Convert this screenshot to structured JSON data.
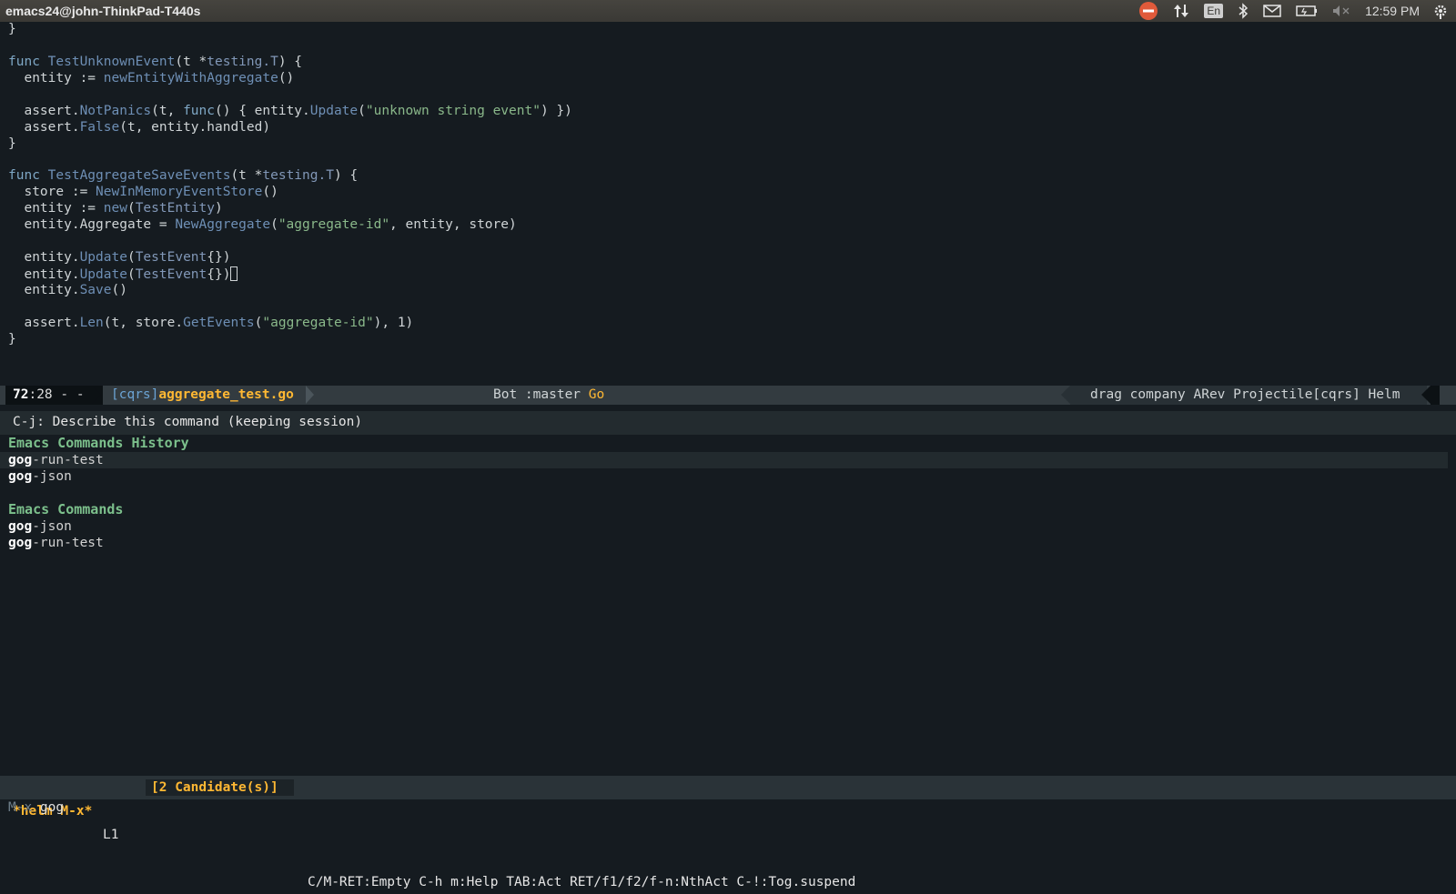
{
  "window": {
    "title": "emacs24@john-ThinkPad-T440s"
  },
  "tray": {
    "lang": "En",
    "clock": "12:59 PM"
  },
  "editor": {
    "lines": [
      [
        {
          "t": "}",
          "c": ""
        }
      ],
      [
        {
          "t": "",
          "c": ""
        }
      ],
      [
        {
          "t": "func ",
          "c": "kw"
        },
        {
          "t": "TestUnknownEvent",
          "c": "fn"
        },
        {
          "t": "(t *",
          "c": ""
        },
        {
          "t": "testing.T",
          "c": "ty"
        },
        {
          "t": ") {",
          "c": ""
        }
      ],
      [
        {
          "t": "  entity := ",
          "c": ""
        },
        {
          "t": "newEntityWithAggregate",
          "c": "fn"
        },
        {
          "t": "()",
          "c": ""
        }
      ],
      [
        {
          "t": "",
          "c": ""
        }
      ],
      [
        {
          "t": "  assert.",
          "c": ""
        },
        {
          "t": "NotPanics",
          "c": "fn"
        },
        {
          "t": "(t, ",
          "c": ""
        },
        {
          "t": "func",
          "c": "kw"
        },
        {
          "t": "() { entity.",
          "c": ""
        },
        {
          "t": "Update",
          "c": "fn"
        },
        {
          "t": "(",
          "c": ""
        },
        {
          "t": "\"unknown string event\"",
          "c": "str"
        },
        {
          "t": ") })",
          "c": ""
        }
      ],
      [
        {
          "t": "  assert.",
          "c": ""
        },
        {
          "t": "False",
          "c": "fn"
        },
        {
          "t": "(t, entity.handled)",
          "c": ""
        }
      ],
      [
        {
          "t": "}",
          "c": ""
        }
      ],
      [
        {
          "t": "",
          "c": ""
        }
      ],
      [
        {
          "t": "func ",
          "c": "kw"
        },
        {
          "t": "TestAggregateSaveEvents",
          "c": "fn"
        },
        {
          "t": "(t *",
          "c": ""
        },
        {
          "t": "testing.T",
          "c": "ty"
        },
        {
          "t": ") {",
          "c": ""
        }
      ],
      [
        {
          "t": "  store := ",
          "c": ""
        },
        {
          "t": "NewInMemoryEventStore",
          "c": "fn"
        },
        {
          "t": "()",
          "c": ""
        }
      ],
      [
        {
          "t": "  entity := ",
          "c": ""
        },
        {
          "t": "new",
          "c": "fn"
        },
        {
          "t": "(",
          "c": ""
        },
        {
          "t": "TestEntity",
          "c": "ty"
        },
        {
          "t": ")",
          "c": ""
        }
      ],
      [
        {
          "t": "  entity.Aggregate = ",
          "c": ""
        },
        {
          "t": "NewAggregate",
          "c": "fn"
        },
        {
          "t": "(",
          "c": ""
        },
        {
          "t": "\"aggregate-id\"",
          "c": "str"
        },
        {
          "t": ", entity, store)",
          "c": ""
        }
      ],
      [
        {
          "t": "",
          "c": ""
        }
      ],
      [
        {
          "t": "  entity.",
          "c": ""
        },
        {
          "t": "Update",
          "c": "fn"
        },
        {
          "t": "(",
          "c": ""
        },
        {
          "t": "TestEvent",
          "c": "ty"
        },
        {
          "t": "{})",
          "c": ""
        }
      ],
      [
        {
          "t": "  entity.",
          "c": ""
        },
        {
          "t": "Update",
          "c": "fn"
        },
        {
          "t": "(",
          "c": ""
        },
        {
          "t": "TestEvent",
          "c": "ty"
        },
        {
          "t": "{})",
          "c": ""
        },
        {
          "t": "",
          "c": "cursor"
        }
      ],
      [
        {
          "t": "  entity.",
          "c": ""
        },
        {
          "t": "Save",
          "c": "fn"
        },
        {
          "t": "()",
          "c": ""
        }
      ],
      [
        {
          "t": "",
          "c": ""
        }
      ],
      [
        {
          "t": "  assert.",
          "c": ""
        },
        {
          "t": "Len",
          "c": "fn"
        },
        {
          "t": "(t, store.",
          "c": ""
        },
        {
          "t": "GetEvents",
          "c": "fn"
        },
        {
          "t": "(",
          "c": ""
        },
        {
          "t": "\"aggregate-id\"",
          "c": "str"
        },
        {
          "t": "), 1)",
          "c": ""
        }
      ],
      [
        {
          "t": "}",
          "c": ""
        }
      ]
    ]
  },
  "modeline": {
    "line": "72",
    "col_rest": ":28 - -",
    "project": "[cqrs]",
    "file": "aggregate_test.go",
    "center": "Bot :master ",
    "lang": "Go",
    "minor_modes": "drag company ARev Projectile[cqrs] Helm"
  },
  "helm": {
    "header": "C-j: Describe this command (keeping session)",
    "sources": [
      {
        "title": "Emacs Commands History",
        "items": [
          {
            "match": "gog",
            "rest": "-run-test"
          },
          {
            "match": "gog",
            "rest": "-json"
          }
        ]
      },
      {
        "title": "Emacs Commands",
        "items": [
          {
            "match": "gog",
            "rest": "-json"
          },
          {
            "match": "gog",
            "rest": "-run-test"
          }
        ]
      }
    ],
    "modeline": {
      "name": "*helm M-x*",
      "line": "L1",
      "count": "[2 Candidate(s)]",
      "keys": "C/M-RET:Empty C-h m:Help TAB:Act RET/f1/f2/f-n:NthAct C-!:Tog.suspend"
    }
  },
  "minibuffer": {
    "prompt": "M-x ",
    "input": "gog"
  }
}
